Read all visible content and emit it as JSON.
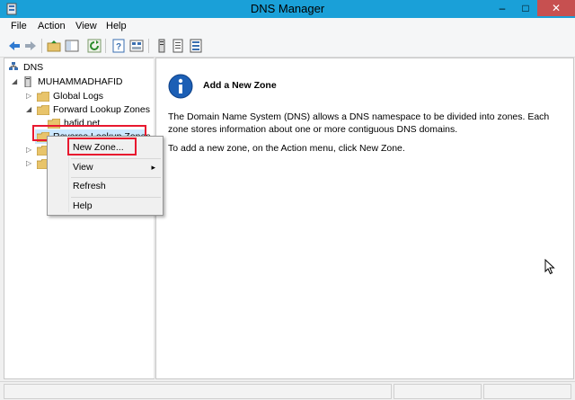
{
  "window": {
    "title": "DNS Manager",
    "controls": {
      "minimize": "–",
      "maximize": "□",
      "close": "✕"
    }
  },
  "menubar": {
    "items": [
      "File",
      "Action",
      "View",
      "Help"
    ]
  },
  "tree": {
    "root": "DNS",
    "server": "MUHAMMADHAFID",
    "global_logs": "Global Logs",
    "forward_zones": "Forward Lookup Zones",
    "forward_child": "hafid.net",
    "reverse_zones": "Reverse Lookup Zones"
  },
  "context_menu": {
    "items": [
      "New Zone...",
      "View",
      "Refresh",
      "Help"
    ],
    "submenu_arrow": "▸"
  },
  "info": {
    "heading": "Add a New Zone",
    "paragraph1": "The Domain Name System (DNS) allows a DNS namespace to be divided into zones. Each zone stores information about one or more contiguous DNS domains.",
    "paragraph2": "To add a new zone, on the Action menu, click New Zone."
  },
  "colors": {
    "titlebar": "#1aa0d8",
    "highlight_box": "#e8182f",
    "info_icon": "#1c5fb5",
    "folder": "#e8c46b"
  }
}
